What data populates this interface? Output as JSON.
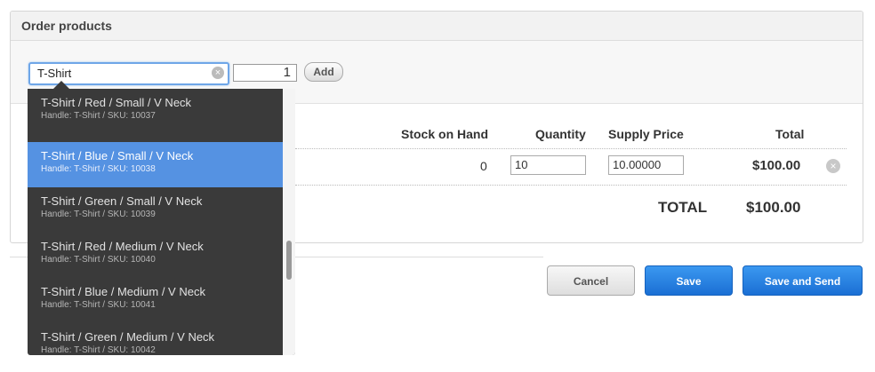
{
  "panel": {
    "title": "Order products"
  },
  "search": {
    "value": "T-Shirt",
    "quantity": "1",
    "add_label": "Add"
  },
  "table": {
    "headers": {
      "stock": "Stock on Hand",
      "quantity": "Quantity",
      "supply_price": "Supply Price",
      "total": "Total"
    },
    "rows": [
      {
        "stock": "0",
        "quantity": "10",
        "supply_price": "10.00000",
        "total": "$100.00"
      }
    ],
    "total_label": "TOTAL",
    "total_value": "$100.00"
  },
  "dropdown": {
    "items": [
      {
        "name": "T-Shirt / Red / Small / V Neck",
        "sub": "Handle: T-Shirt / SKU: 10037"
      },
      {
        "name": "T-Shirt / Blue / Small / V Neck",
        "sub": "Handle: T-Shirt / SKU: 10038"
      },
      {
        "name": "T-Shirt / Green / Small / V Neck",
        "sub": "Handle: T-Shirt / SKU: 10039"
      },
      {
        "name": "T-Shirt / Red / Medium / V Neck",
        "sub": "Handle: T-Shirt / SKU: 10040"
      },
      {
        "name": "T-Shirt / Blue / Medium / V Neck",
        "sub": "Handle: T-Shirt / SKU: 10041"
      },
      {
        "name": "T-Shirt / Green / Medium / V Neck",
        "sub": "Handle: T-Shirt / SKU: 10042"
      }
    ],
    "active_index": 1
  },
  "actions": {
    "cancel_label": "Cancel",
    "save_label": "Save",
    "save_send_label": "Save and Send"
  },
  "colors": {
    "accent": "#1a6fd4",
    "highlight": "#5592e2",
    "dropdown_bg": "#3a3a3a"
  }
}
